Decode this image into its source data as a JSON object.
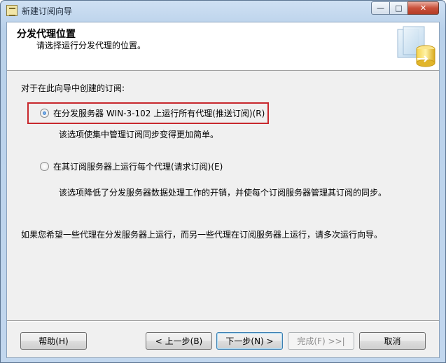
{
  "window": {
    "title": "新建订阅向导",
    "min_label": "—",
    "max_label": "□",
    "close_label": "✕"
  },
  "header": {
    "title": "分发代理位置",
    "subtitle": "请选择运行分发代理的位置。",
    "graphic_icon": "wizard-database-icon"
  },
  "main": {
    "prompt": "对于在此向导中创建的订阅:",
    "options": [
      {
        "label": "在分发服务器 WIN-3-102 上运行所有代理(推送订阅)(R)",
        "description": "该选项使集中管理订阅同步变得更加简单。",
        "selected": true
      },
      {
        "label": "在其订阅服务器上运行每个代理(请求订阅)(E)",
        "description": "该选项降低了分发服务器数据处理工作的开销，并使每个订阅服务器管理其订阅的同步。",
        "selected": false
      }
    ],
    "note": "如果您希望一些代理在分发服务器上运行，而另一些代理在订阅服务器上运行，请多次运行向导。"
  },
  "footer": {
    "help": "帮助(H)",
    "back": "< 上一步(B)",
    "next": "下一步(N) >",
    "finish": "完成(F) >>|",
    "cancel": "取消"
  },
  "colors": {
    "highlight_border": "#c8282d",
    "title_bar": "#b9d1ea",
    "dialog_bg": "#f0f0f0"
  }
}
